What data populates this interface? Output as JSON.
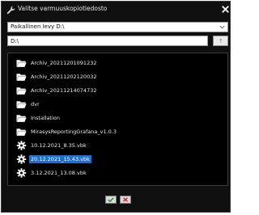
{
  "window": {
    "title": "Valitse varmuuskopiotiedosto"
  },
  "drive_select": {
    "selected": "Paikallinen levy D:\\"
  },
  "path_field": {
    "value": "D:\\"
  },
  "up_button": {
    "label": "↑"
  },
  "files": [
    {
      "name": "Archiv_20211201091232",
      "type": "folder",
      "selected": false
    },
    {
      "name": "Archiv_20211202120032",
      "type": "folder",
      "selected": false
    },
    {
      "name": "Archiv_20211214074732",
      "type": "folder",
      "selected": false
    },
    {
      "name": "dvr",
      "type": "folder",
      "selected": false
    },
    {
      "name": "Installation",
      "type": "folder",
      "selected": false
    },
    {
      "name": "MirasysReportingGrafana_v1.0.3",
      "type": "folder",
      "selected": false
    },
    {
      "name": "10.12.2021_8.35.vbk",
      "type": "backup-file",
      "selected": false
    },
    {
      "name": "20.12.2021_15.43.vbk",
      "type": "backup-file",
      "selected": true
    },
    {
      "name": "3.12.2021_13.08.vbk",
      "type": "backup-file",
      "selected": false
    }
  ],
  "icons": {
    "title": "wrench-icon",
    "close": "close-icon",
    "folder": "folder-icon",
    "file": "gear-icon",
    "ok": "checkmark-icon",
    "cancel": "x-icon"
  },
  "colors": {
    "background": "#0f0f0f",
    "selection": "#1f6fd0",
    "ok": "#2e9b2e",
    "cancel": "#d22b2b"
  }
}
